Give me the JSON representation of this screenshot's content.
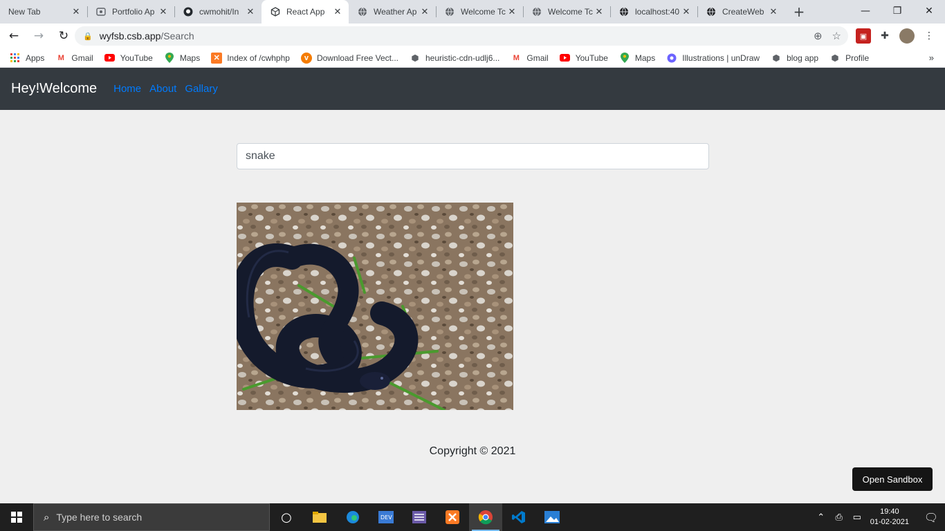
{
  "browser": {
    "tabs": [
      {
        "title": "New Tab",
        "icon": "blank-icon"
      },
      {
        "title": "Portfolio Ap",
        "icon": "portfolio-icon"
      },
      {
        "title": "cwmohit/In",
        "icon": "github-icon"
      },
      {
        "title": "React App",
        "icon": "codesandbox-icon"
      },
      {
        "title": "Weather Ap",
        "icon": "globe-icon"
      },
      {
        "title": "Welcome Tc",
        "icon": "globe-icon"
      },
      {
        "title": "Welcome Tc",
        "icon": "globe-icon"
      },
      {
        "title": "localhost:40",
        "icon": "globe-icon"
      },
      {
        "title": "CreateWeb",
        "icon": "globe-icon"
      }
    ],
    "url_host": "wyfsb.csb.app",
    "url_path": "/Search",
    "bookmarks": [
      {
        "label": "Apps"
      },
      {
        "label": "Gmail"
      },
      {
        "label": "YouTube"
      },
      {
        "label": "Maps"
      },
      {
        "label": "Index of /cwhphp"
      },
      {
        "label": "Download Free Vect..."
      },
      {
        "label": "heuristic-cdn-udlj6..."
      },
      {
        "label": "Gmail"
      },
      {
        "label": "YouTube"
      },
      {
        "label": "Maps"
      },
      {
        "label": "Illustrations | unDraw"
      },
      {
        "label": "blog app"
      },
      {
        "label": "Profile"
      }
    ]
  },
  "navbar": {
    "brand": "Hey!Welcome",
    "links": [
      "Home",
      "About",
      "Gallary"
    ],
    "link_color": "#007bff"
  },
  "search": {
    "value": "snake"
  },
  "result": {
    "image": "black-snake-photo"
  },
  "footer": {
    "copyright": "Copyright © 2021"
  },
  "sandbox_button": "Open Sandbox",
  "taskbar": {
    "search_placeholder": "Type here to search",
    "time": "19:40",
    "date": "01-02-2021"
  }
}
